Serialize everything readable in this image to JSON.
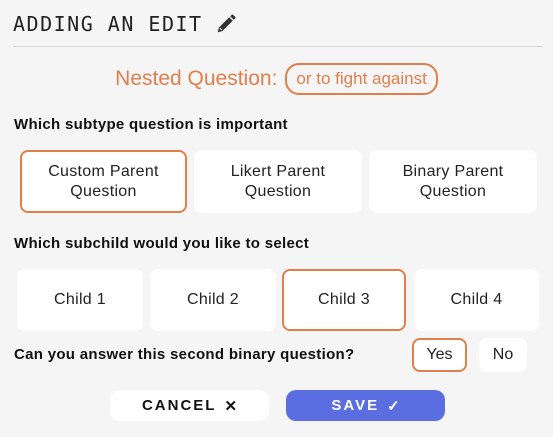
{
  "header": {
    "title": "ADDING AN EDIT",
    "edit_icon": "pencil-icon"
  },
  "nested": {
    "label": "Nested Question:",
    "value": "or to fight against"
  },
  "q1": {
    "label": "Which subtype question is important",
    "options": [
      {
        "line1": "Custom Parent",
        "line2": "Question"
      },
      {
        "line1": "Likert Parent",
        "line2": "Question"
      },
      {
        "line1": "Binary Parent",
        "line2": "Question"
      }
    ],
    "selected": 0
  },
  "q2": {
    "label": "Which subchild would you like to select",
    "options": [
      "Child 1",
      "Child 2",
      "Child 3",
      "Child 4"
    ],
    "selected": 2
  },
  "q3": {
    "label": "Can you answer this second binary question?",
    "yes": "Yes",
    "no": "No",
    "selected": "Yes"
  },
  "actions": {
    "cancel": "CANCEL",
    "cancel_icon": "✕",
    "save": "SAVE",
    "save_icon": "✓"
  },
  "colors": {
    "accent": "#e07f4b",
    "primary": "#5b6ee1",
    "background": "#f5f5f5"
  }
}
